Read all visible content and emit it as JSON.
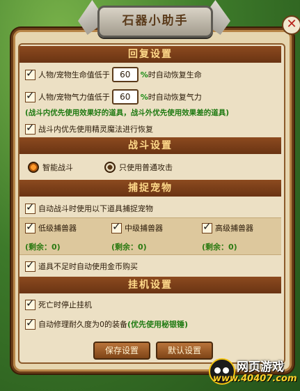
{
  "window": {
    "title": "石器小助手",
    "close_glyph": "✕"
  },
  "recovery": {
    "heading": "回复设置",
    "hp_label": "人物/宠物生命值低于",
    "hp_value": "60",
    "hp_suffix_pct": "%",
    "hp_suffix": "时自动恢复生命",
    "mp_label": "人物/宠物气力值低于",
    "mp_value": "60",
    "mp_suffix_pct": "%",
    "mp_suffix": "时自动恢复气力",
    "note": "(战斗内优先使用效果好的道具，战斗外优先使用效果差的道具)",
    "spirit_magic": "战斗内优先使用精灵魔法进行恢复"
  },
  "battle": {
    "heading": "战斗设置",
    "smart": "智能战斗",
    "normal_only": "只使用普通攻击",
    "selected": "smart"
  },
  "capture": {
    "heading": "捕捉宠物",
    "auto_use": "自动战斗时使用以下道具捕捉宠物",
    "items": [
      {
        "label": "低级捕兽器",
        "remain": "(剩余：0)"
      },
      {
        "label": "中级捕兽器",
        "remain": "(剩余：0)"
      },
      {
        "label": "高级捕兽器",
        "remain": "(剩余：0)"
      }
    ],
    "auto_buy": "道具不足时自动使用金币购买"
  },
  "idle": {
    "heading": "挂机设置",
    "stop_on_death": "死亡时停止挂机",
    "auto_repair": "自动修理耐久度为0的装备",
    "auto_repair_note": "(优先使用秘银锤)"
  },
  "buttons": {
    "save": "保存设置",
    "default": "默认设置"
  },
  "logo": {
    "line1": "网页游戏",
    "line2": "www.40407.com"
  },
  "icons": [
    "bone-icon",
    "close-icon",
    "checkbox-icon",
    "radio-icon",
    "logo-icon"
  ]
}
